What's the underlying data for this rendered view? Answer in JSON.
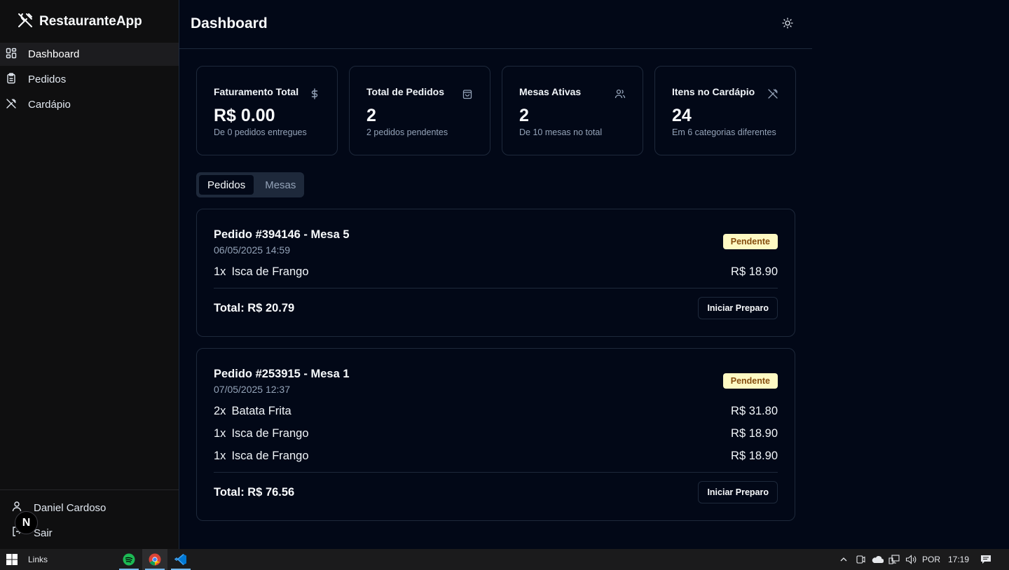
{
  "app": {
    "name": "RestauranteApp"
  },
  "sidebar": {
    "items": [
      {
        "label": "Dashboard",
        "icon": "dashboard-icon",
        "active": true
      },
      {
        "label": "Pedidos",
        "icon": "clipboard-icon",
        "active": false
      },
      {
        "label": "Cardápio",
        "icon": "utensils-icon",
        "active": false
      }
    ],
    "user_name": "Daniel Cardoso",
    "logout_label": "Sair"
  },
  "header": {
    "title": "Dashboard",
    "theme_icon": "sun-icon"
  },
  "stats": [
    {
      "title": "Faturamento Total",
      "value": "R$ 0.00",
      "sub": "De 0 pedidos entregues",
      "icon": "dollar-icon"
    },
    {
      "title": "Total de Pedidos",
      "value": "2",
      "sub": "2 pedidos pendentes",
      "icon": "shopping-bag-icon"
    },
    {
      "title": "Mesas Ativas",
      "value": "2",
      "sub": "De 10 mesas no total",
      "icon": "users-icon"
    },
    {
      "title": "Itens no Cardápio",
      "value": "24",
      "sub": "Em 6 categorias diferentes",
      "icon": "utensils-icon"
    }
  ],
  "tabs": [
    {
      "label": "Pedidos",
      "active": true
    },
    {
      "label": "Mesas",
      "active": false
    }
  ],
  "orders": [
    {
      "title": "Pedido #394146 - Mesa 5",
      "date": "06/05/2025 14:59",
      "status": "Pendente",
      "items": [
        {
          "qty": "1x",
          "name": "Isca de Frango",
          "price": "R$ 18.90"
        }
      ],
      "total": "Total: R$ 20.79",
      "action": "Iniciar Preparo"
    },
    {
      "title": "Pedido #253915 - Mesa 1",
      "date": "07/05/2025 12:37",
      "status": "Pendente",
      "items": [
        {
          "qty": "2x",
          "name": "Batata Frita",
          "price": "R$ 31.80"
        },
        {
          "qty": "1x",
          "name": "Isca de Frango",
          "price": "R$ 18.90"
        },
        {
          "qty": "1x",
          "name": "Isca de Frango",
          "price": "R$ 18.90"
        }
      ],
      "total": "Total: R$ 76.56",
      "action": "Iniciar Preparo"
    }
  ],
  "colors": {
    "background": "#020817",
    "sidebar": "#0f0f10",
    "badge_bg": "#fef9c3",
    "badge_text": "#854d0e",
    "border": "#1e293b"
  },
  "taskbar": {
    "links_label": "Links",
    "apps": [
      "spotify-icon",
      "chrome-icon",
      "vscode-icon"
    ],
    "language": "POR",
    "time": "17:19"
  }
}
